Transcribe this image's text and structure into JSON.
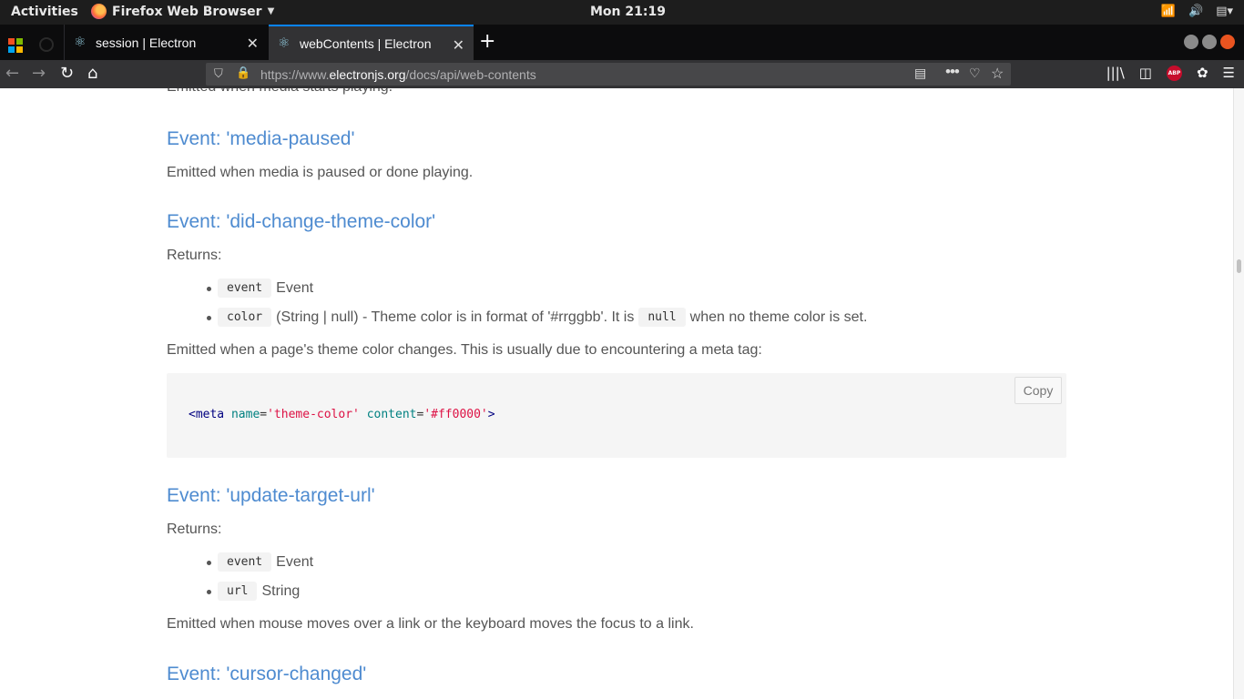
{
  "topbar": {
    "activities": "Activities",
    "app_name": "Firefox Web Browser",
    "clock": "Mon 21:19"
  },
  "tabs": [
    {
      "title": "session | Electron"
    },
    {
      "title": "webContents | Electron",
      "active": true
    }
  ],
  "url": {
    "prefix": "https://www.",
    "domain": "electronjs.org",
    "path": "/docs/api/web-contents"
  },
  "content": {
    "cut_text": "Emitted when media starts playing.",
    "media_paused": {
      "heading": "Event: 'media-paused'",
      "desc": "Emitted when media is paused or done playing."
    },
    "theme_color": {
      "heading": "Event: 'did-change-theme-color'",
      "returns": "Returns:",
      "item1_code": "event",
      "item1_text": "Event",
      "item2_code": "color",
      "item2_text": "(String | null) - Theme color is in format of '#rrggbb'. It is",
      "item2_code2": "null",
      "item2_text2": "when no theme color is set.",
      "desc": "Emitted when a page's theme color changes. This is usually due to encountering a meta tag:",
      "code": {
        "tag_open": "<meta",
        "attr1": "name",
        "eq": "=",
        "val1": "'theme-color'",
        "attr2": "content",
        "val2": "'#ff0000'",
        "tag_close": ">"
      },
      "copy_label": "Copy"
    },
    "update_target_url": {
      "heading": "Event: 'update-target-url'",
      "returns": "Returns:",
      "item1_code": "event",
      "item1_text": "Event",
      "item2_code": "url",
      "item2_text": "String",
      "desc": "Emitted when mouse moves over a link or the keyboard moves the focus to a link."
    },
    "cursor_changed": {
      "heading": "Event: 'cursor-changed'"
    }
  }
}
